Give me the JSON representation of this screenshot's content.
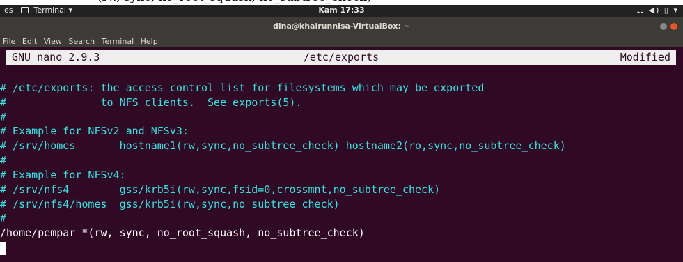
{
  "system_bar": {
    "partial_left": "es",
    "app_menu": "Terminal ▾",
    "clock": "Kam 17:33",
    "tray": "⚋ ◀) ▯ ▾"
  },
  "window": {
    "title": "dina@khairunnisa-VirtualBox: ~",
    "button_colors": [
      "#888888",
      "#e95420"
    ]
  },
  "menubar": {
    "items": [
      "File",
      "Edit",
      "View",
      "Search",
      "Terminal",
      "Help"
    ]
  },
  "nano": {
    "version": "GNU nano 2.9.3",
    "filename": "/etc/exports",
    "status": "Modified"
  },
  "file_lines": [
    "# /etc/exports: the access control list for filesystems which may be exported",
    "#               to NFS clients.  See exports(5).",
    "#",
    "# Example for NFSv2 and NFSv3:",
    "# /srv/homes       hostname1(rw,sync,no_subtree_check) hostname2(ro,sync,no_subtree_check)",
    "#",
    "# Example for NFSv4:",
    "# /srv/nfs4        gss/krb5i(rw,sync,fsid=0,crossmnt,no_subtree_check)",
    "# /srv/nfs4/homes  gss/krb5i(rw,sync,no_subtree_check)",
    "#",
    "/home/pempar *(rw, sync, no_root_squash, no_subtree_check)"
  ],
  "colors": {
    "terminal_bg": "#300a24",
    "comment": "#34e2e2",
    "text": "#ffffff"
  }
}
